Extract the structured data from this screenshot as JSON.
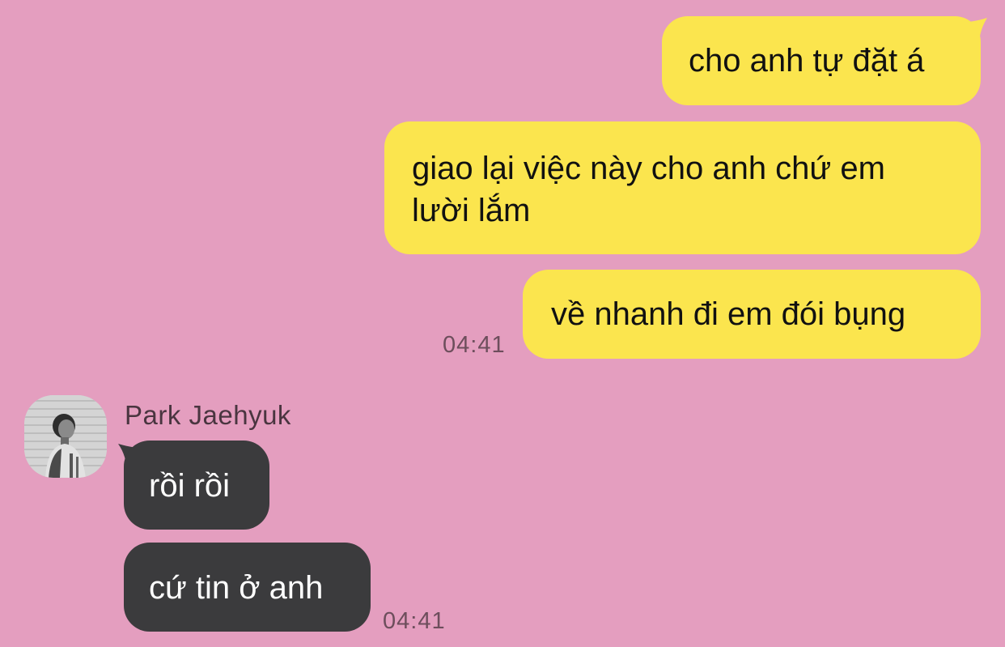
{
  "colors": {
    "background": "#e49ebf",
    "outgoing_bubble": "#fbe54e",
    "incoming_bubble": "#3b3b3d"
  },
  "outgoing": [
    {
      "text": "cho anh tự đặt á"
    },
    {
      "line1": "giao lại việc này cho anh chứ em",
      "line2": "lười lắm"
    },
    {
      "text": "về nhanh đi em đói bụng"
    }
  ],
  "outgoing_time": "04:41",
  "incoming": {
    "sender": "Park Jaehyuk",
    "messages": [
      {
        "text": "rồi rồi"
      },
      {
        "text": "cứ tin ở anh"
      }
    ],
    "time": "04:41"
  }
}
